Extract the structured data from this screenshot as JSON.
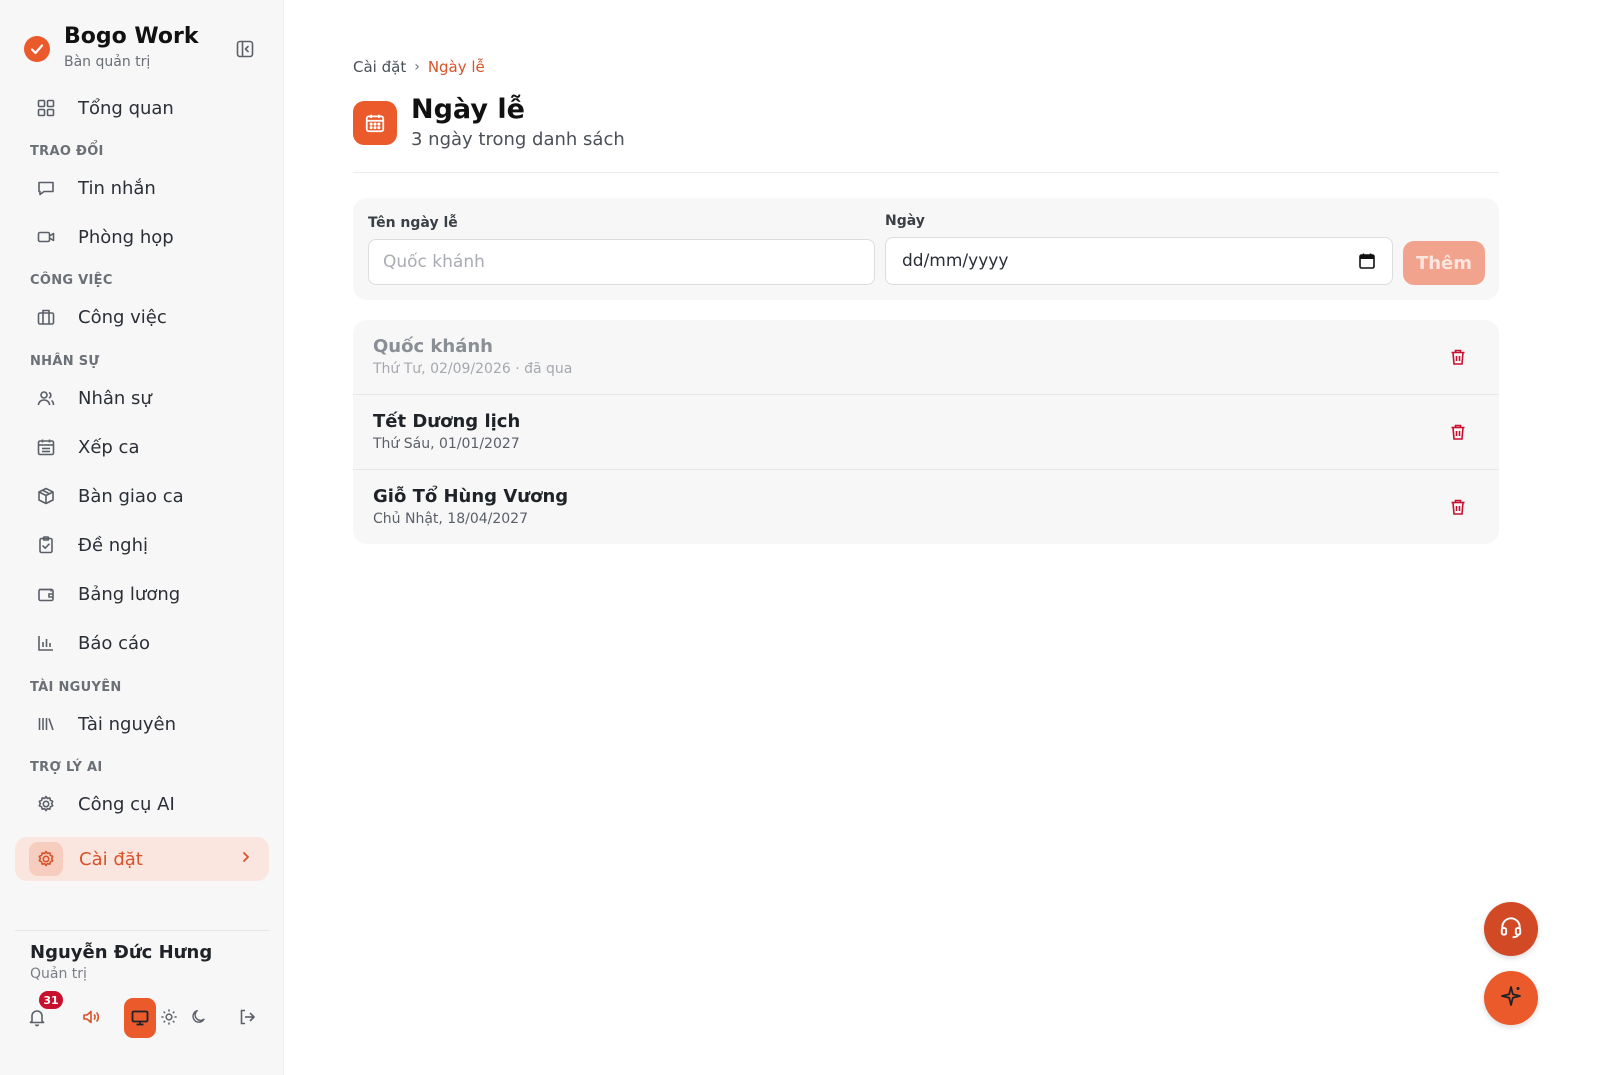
{
  "app": {
    "name": "Bogo Work",
    "subtitle": "Bàn quản trị"
  },
  "sidebar": {
    "overview": "Tổng quan",
    "sections": {
      "communication": "TRAO ĐỔI",
      "work": "CÔNG VIỆC",
      "hr": "NHÂN SỰ",
      "resources": "TÀI NGUYÊN",
      "ai": "TRỢ LÝ AI"
    },
    "items": {
      "messages": "Tin nhắn",
      "meeting_rooms": "Phòng họp",
      "tasks": "Công việc",
      "staff": "Nhân sự",
      "shifts": "Xếp ca",
      "handover": "Bàn giao ca",
      "requests": "Đề nghị",
      "payroll": "Bảng lương",
      "reports": "Báo cáo",
      "resources": "Tài nguyên",
      "ai_tools": "Công cụ AI",
      "settings": "Cài đặt"
    }
  },
  "user": {
    "name": "Nguyễn Đức Hưng",
    "role": "Quản trị",
    "notifications": "31"
  },
  "breadcrumb": {
    "parent": "Cài đặt",
    "separator": "›",
    "current": "Ngày lễ"
  },
  "page": {
    "title": "Ngày lễ",
    "subtitle": "3 ngày trong danh sách"
  },
  "form": {
    "name_label": "Tên ngày lễ",
    "name_placeholder": "Quốc khánh",
    "date_label": "Ngày",
    "date_placeholder": "dd/mm/yyyy",
    "add_label": "Thêm"
  },
  "holidays": [
    {
      "name": "Quốc khánh",
      "date": "Thứ Tư, 02/09/2026 · đã qua",
      "past": true
    },
    {
      "name": "Tết Dương lịch",
      "date": "Thứ Sáu, 01/01/2027",
      "past": false
    },
    {
      "name": "Giỗ Tổ Hùng Vương",
      "date": "Chủ Nhật, 18/04/2027",
      "past": false
    }
  ],
  "colors": {
    "accent": "#ea5a2b",
    "accent_light": "#fbe5df",
    "danger": "#c8102e"
  },
  "icons": {
    "overview": "grid-icon",
    "messages": "chat-icon",
    "meeting_rooms": "video-icon",
    "tasks": "briefcase-icon",
    "staff": "users-icon",
    "shifts": "calendar-icon",
    "handover": "package-icon",
    "requests": "clipboard-check-icon",
    "payroll": "wallet-icon",
    "reports": "bar-chart-icon",
    "resources": "library-icon",
    "ai_tools": "gear-icon",
    "settings": "gear-icon"
  }
}
